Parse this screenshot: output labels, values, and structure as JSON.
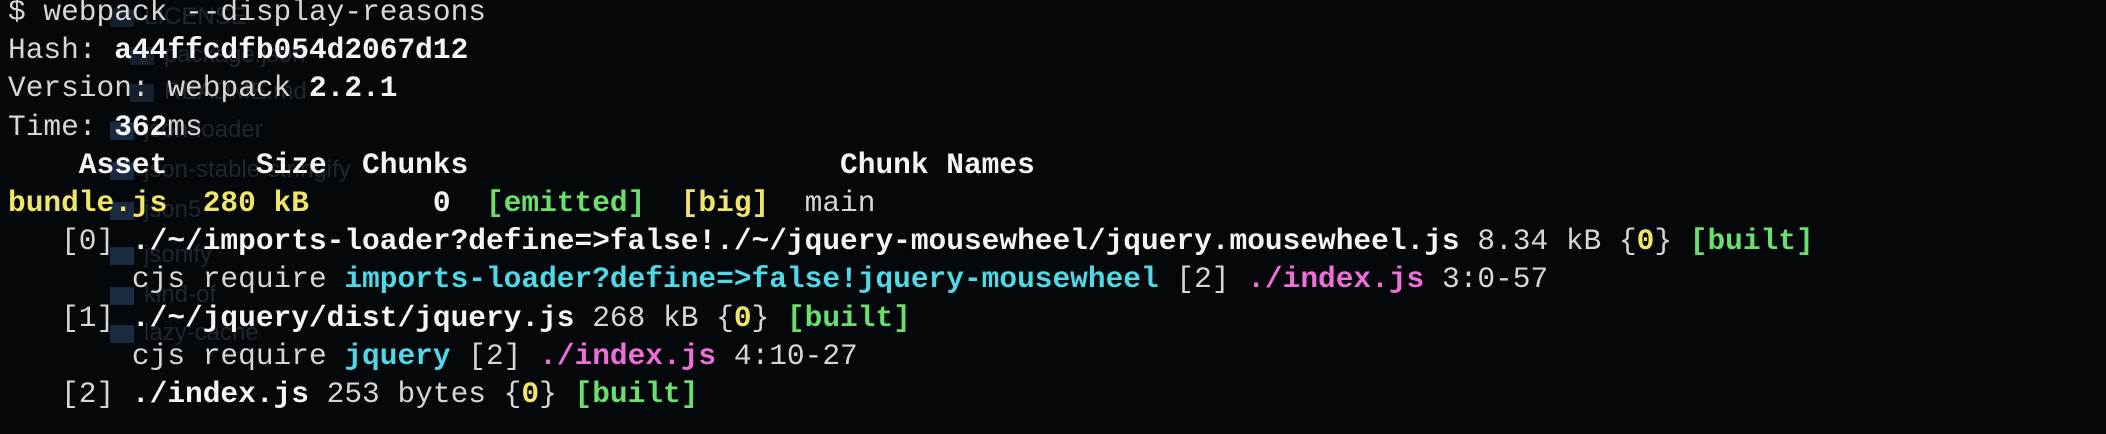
{
  "ghost_tree": [
    {
      "label": "LICENSE",
      "icon": "file-icon"
    },
    {
      "label": "package.json",
      "icon": "file-icon"
    },
    {
      "label": "README.md",
      "icon": "file-icon"
    },
    {
      "label": "json-loader",
      "icon": "folder-icon"
    },
    {
      "label": "json-stable-stringify",
      "icon": "folder-icon"
    },
    {
      "label": "json5",
      "icon": "folder-icon"
    },
    {
      "label": "jsonify",
      "icon": "folder-icon"
    },
    {
      "label": "kind-of",
      "icon": "folder-icon"
    },
    {
      "label": "lazy-cache",
      "icon": "folder-icon"
    }
  ],
  "terminal": {
    "prompt": "$ ",
    "command": "webpack --display-reasons",
    "hash_label": "Hash: ",
    "hash_value": "a44ffcdfb054d2067d12",
    "version_label": "Version: webpack ",
    "version_value": "2.2.1",
    "time_label": "Time: ",
    "time_value": "362",
    "time_unit": "ms",
    "table_header": {
      "asset": "    Asset",
      "size": "     Size",
      "chunks": "  Chunks",
      "chunk_names": "                     Chunk Names"
    },
    "bundle": {
      "name": "bundle.js",
      "size": "  280 kB",
      "chunk": "       0",
      "emitted": "[emitted]",
      "big": "[big]",
      "chunk_name": "main"
    },
    "modules": [
      {
        "id": "   [0] ",
        "path": "./~/imports-loader?define=>false!./~/jquery-mousewheel/jquery.mousewheel.js",
        "size": " 8.34 kB {",
        "chunk": "0",
        "chunk_close": "} ",
        "status": "[built]",
        "reason": {
          "indent": "       cjs require ",
          "request": "imports-loader?define=>false!jquery-mousewheel",
          "ref": " [2] ",
          "from": "./index.js",
          "loc": " 3:0-57"
        }
      },
      {
        "id": "   [1] ",
        "path": "./~/jquery/dist/jquery.js",
        "size": " 268 kB {",
        "chunk": "0",
        "chunk_close": "} ",
        "status": "[built]",
        "reason": {
          "indent": "       cjs require ",
          "request": "jquery",
          "ref": " [2] ",
          "from": "./index.js",
          "loc": " 4:10-27"
        }
      },
      {
        "id": "   [2] ",
        "path": "./index.js",
        "size": " 253 bytes {",
        "chunk": "0",
        "chunk_close": "} ",
        "status": "[built]"
      }
    ]
  }
}
